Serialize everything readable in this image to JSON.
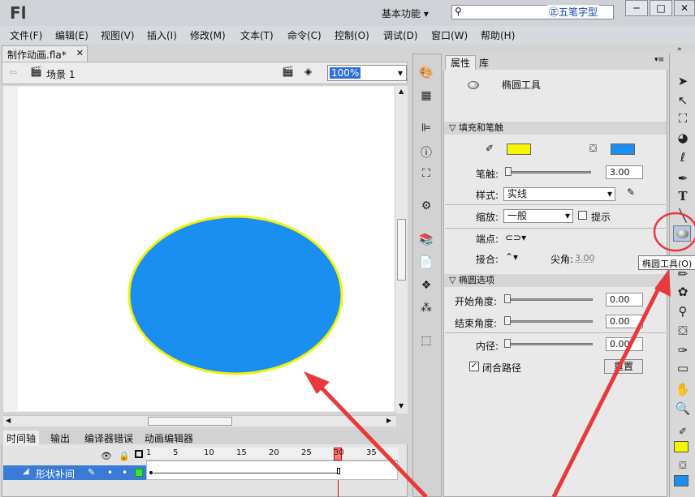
{
  "app": {
    "logo": "Fl",
    "workspace": "基本功能",
    "watermark": "五笔字型"
  },
  "window_buttons": [
    "─",
    "□",
    "✕"
  ],
  "menu": [
    "文件(F)",
    "编辑(E)",
    "视图(V)",
    "插入(I)",
    "修改(M)",
    "文本(T)",
    "命令(C)",
    "控制(O)",
    "调试(D)",
    "窗口(W)",
    "帮助(H)"
  ],
  "document": {
    "tab": "制作动画.fla*",
    "scene": "场景 1",
    "zoom": "100%"
  },
  "stage": {
    "ellipse_fill": "#1a8ff0",
    "ellipse_stroke": "#f2f20a"
  },
  "timeline": {
    "tabs": [
      "时间轴",
      "输出",
      "编译器错误",
      "动画编辑器"
    ],
    "frame_numbers": [
      "1",
      "5",
      "10",
      "15",
      "20",
      "25",
      "30",
      "35"
    ],
    "current_frame": "30",
    "layer_name": "形状补间"
  },
  "properties": {
    "tabs": [
      "属性",
      "库"
    ],
    "tool_name": "椭圆工具",
    "section_fill_stroke": "填充和笔触",
    "stroke_color": "#f6f600",
    "fill_color": "#1a8ff0",
    "stroke_label": "笔触:",
    "stroke_value": "3.00",
    "style_label": "样式:",
    "style_value": "实线",
    "scale_label": "缩放:",
    "scale_value": "一般",
    "hint_label": "提示",
    "cap_label": "端点:",
    "join_label": "接合:",
    "miter_label": "尖角:",
    "miter_value": "3.00",
    "section_ellipse": "椭圆选项",
    "start_angle_label": "开始角度:",
    "start_angle_value": "0.00",
    "end_angle_label": "结束角度:",
    "end_angle_value": "0.00",
    "inner_label": "内径:",
    "inner_value": "0.00",
    "close_path_label": "闭合路径",
    "reset_label": "重置"
  },
  "tooltip": "椭圆工具(O)",
  "annotation_color": "#e83a3a"
}
